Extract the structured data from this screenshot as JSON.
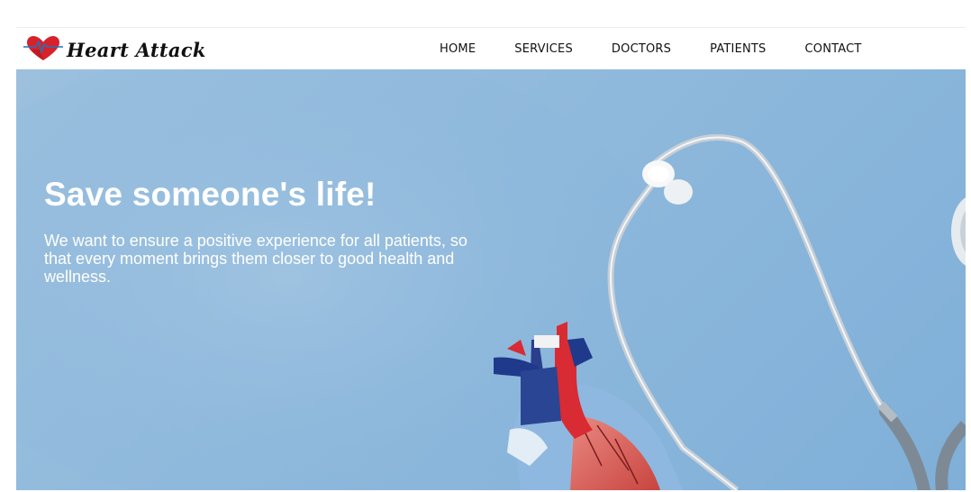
{
  "brand": {
    "name": "Heart Attack",
    "logo_icon": "heart-pulse-icon",
    "accent_color": "#d7222b"
  },
  "nav": {
    "items": [
      {
        "label": "HOME"
      },
      {
        "label": "SERVICES"
      },
      {
        "label": "DOCTORS"
      },
      {
        "label": "PATIENTS"
      },
      {
        "label": "CONTACT"
      }
    ]
  },
  "hero": {
    "title": "Save someone's life!",
    "text": "We want to ensure a positive experience for all patients, so that every moment brings them closer to good health and wellness.",
    "background_color": "#8fb9dc"
  }
}
